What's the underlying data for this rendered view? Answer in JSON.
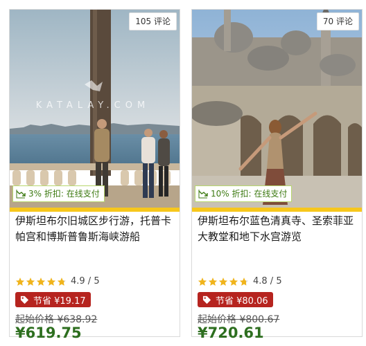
{
  "cards": [
    {
      "reviews": "105 评论",
      "discount": "3% 折扣: 在线支付",
      "title": "伊斯坦布尔旧城区步行游，托普卡帕宫和博斯普鲁斯海峡游船",
      "rating": "4.9 / 5",
      "rating_value": 4.9,
      "savings": "节省 ¥19.17",
      "original_price": "起始价格 ¥638.92",
      "price": "¥619.75",
      "watermark": "KATALAY.COM"
    },
    {
      "reviews": "70 评论",
      "discount": "10% 折扣: 在线支付",
      "title": "伊斯坦布尔蓝色清真寺、圣索菲亚大教堂和地下水宫游览",
      "rating": "4.8 / 5",
      "rating_value": 4.8,
      "savings": "节省 ¥80.06",
      "original_price": "起始价格 ¥800.67",
      "price": "¥720.61"
    }
  ],
  "colors": {
    "accent_bar": "#f7c71c",
    "savings_bg": "#b6241f",
    "price_green": "#2d6e1f",
    "discount_green": "#3d7a12",
    "star": "#f0b41c"
  },
  "icons": {
    "discount": "trending-down-icon",
    "savings": "tag-icon",
    "rating": "star-icon"
  }
}
